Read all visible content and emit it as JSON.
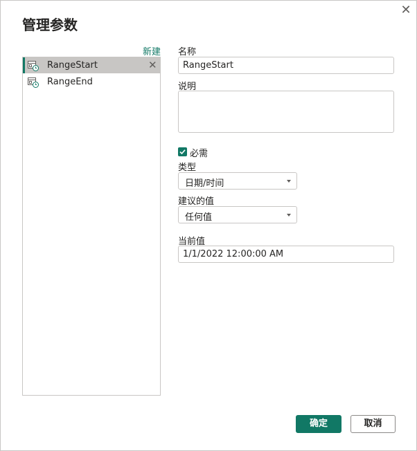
{
  "dialog": {
    "title": "管理参数",
    "close_label": "✕",
    "new_link": "新建"
  },
  "parameters": [
    {
      "label": "RangeStart",
      "selected": true
    },
    {
      "label": "RangeEnd",
      "selected": false
    }
  ],
  "form": {
    "name_label": "名称",
    "name_value": "RangeStart",
    "description_label": "说明",
    "description_value": "",
    "required_label": "必需",
    "required_checked": true,
    "type_label": "类型",
    "type_value": "日期/时间",
    "suggested_label": "建议的值",
    "suggested_value": "任何值",
    "current_label": "当前值",
    "current_value": "1/1/2022 12:00:00 AM"
  },
  "buttons": {
    "ok": "确定",
    "cancel": "取消"
  },
  "colors": {
    "accent": "#117865",
    "selected_bg": "#c8c6c4",
    "border": "#c8c6c4"
  }
}
